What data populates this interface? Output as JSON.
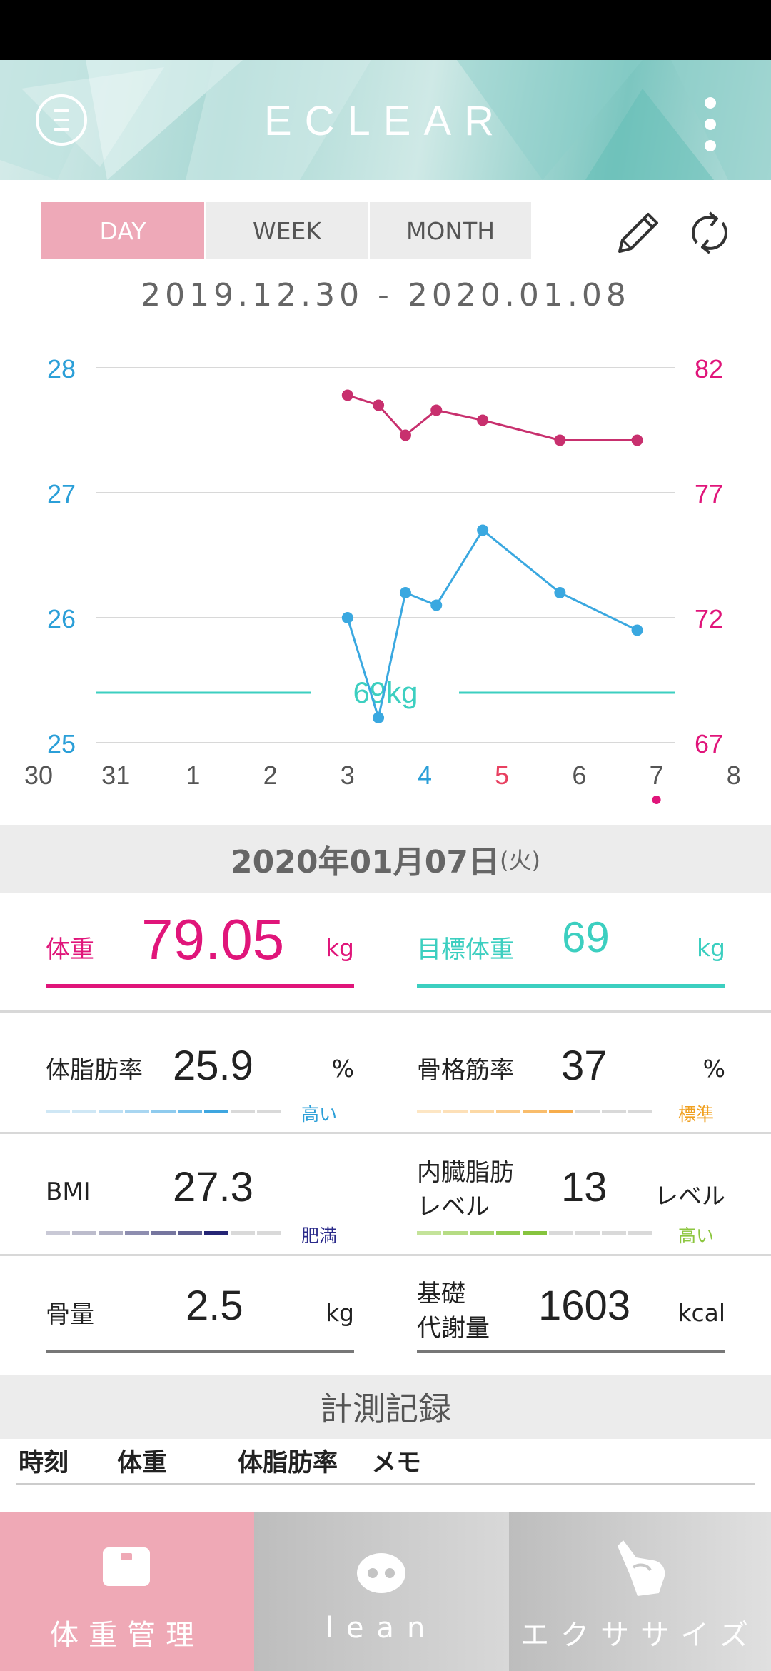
{
  "app": {
    "title": "ECLEAR"
  },
  "header": {
    "menu_icon": "menu-circle-icon",
    "more_icon": "kebab-menu-icon"
  },
  "tabs": [
    {
      "label": "DAY",
      "active": true
    },
    {
      "label": "WEEK",
      "active": false
    },
    {
      "label": "MONTH",
      "active": false
    }
  ],
  "toolbar": {
    "edit_icon": "pencil-icon",
    "sync_icon": "refresh-icon"
  },
  "date_range": "2019.12.30 - 2020.01.08",
  "chart_data": {
    "type": "line",
    "x_ticks": [
      "30",
      "31",
      "1",
      "2",
      "3",
      "4",
      "5",
      "6",
      "7",
      "8"
    ],
    "x_tick_colors": [
      "#555",
      "#555",
      "#555",
      "#555",
      "#555",
      "#2b9fd8",
      "#e84060",
      "#555",
      "#555",
      "#555"
    ],
    "y_left": {
      "ticks": [
        "28",
        "27",
        "26",
        "25"
      ],
      "range": [
        25,
        28
      ],
      "color": "#2b9fd8"
    },
    "y_right": {
      "ticks": [
        "82",
        "77",
        "72",
        "67"
      ],
      "range": [
        67,
        82
      ],
      "color": "#e0157a"
    },
    "series": [
      {
        "axis": "right",
        "color": "#c8306e",
        "x": [
          3,
          3.4,
          3.75,
          4.15,
          4.75,
          5.75,
          6.75
        ],
        "values": [
          80.9,
          80.5,
          79.3,
          80.3,
          79.9,
          79.1,
          79.1
        ]
      },
      {
        "axis": "left",
        "color": "#3aa8e0",
        "x": [
          3,
          3.4,
          3.75,
          4.15,
          4.75,
          5.75,
          6.75
        ],
        "values": [
          26.0,
          25.2,
          26.2,
          26.1,
          26.7,
          26.2,
          25.9
        ]
      }
    ],
    "target": {
      "label": "69kg",
      "value": 69,
      "color": "#3ccfc0"
    },
    "selected_x": 7,
    "grid": true
  },
  "selected_date": {
    "main": "2020年01月07日",
    "weekday": "(火)"
  },
  "weight": {
    "label": "体重",
    "value": "79.05",
    "unit": "kg",
    "color": "#e0157a"
  },
  "target_weight": {
    "label": "目標体重",
    "value": "69",
    "unit": "kg",
    "color": "#3ccfc0"
  },
  "metrics": {
    "body_fat": {
      "label": "体脂肪率",
      "value": "25.9",
      "unit": "%",
      "level": "高い",
      "level_color": "#2b9fd8",
      "level_index": 6
    },
    "muscle": {
      "label": "骨格筋率",
      "value": "37",
      "unit": "%",
      "level": "標準",
      "level_color": "#f0a020",
      "level_index": 6
    },
    "bmi": {
      "label": "BMI",
      "value": "27.3",
      "unit": "",
      "level": "肥満",
      "level_color": "#2a2a8a",
      "level_index": 7
    },
    "visceral": {
      "label_line1": "内臓脂肪",
      "label_line2": "レベル",
      "value": "13",
      "unit": "レベル",
      "level": "高い",
      "level_color": "#8cc63f",
      "level_index": 5
    },
    "bone": {
      "label": "骨量",
      "value": "2.5",
      "unit": "kg"
    },
    "bmr": {
      "label_line1": "基礎",
      "label_line2": "代謝量",
      "value": "1603",
      "unit": "kcal"
    }
  },
  "records": {
    "title": "計測記録",
    "columns": [
      "時刻",
      "体重",
      "体脂肪率",
      "メモ"
    ]
  },
  "bottom_nav": [
    {
      "label": "体重管理",
      "icon": "scale-icon",
      "active": true
    },
    {
      "label": "lean",
      "icon": "lean-face-icon",
      "active": false
    },
    {
      "label": "エクササイズ",
      "icon": "exercise-hand-icon",
      "active": false
    }
  ]
}
